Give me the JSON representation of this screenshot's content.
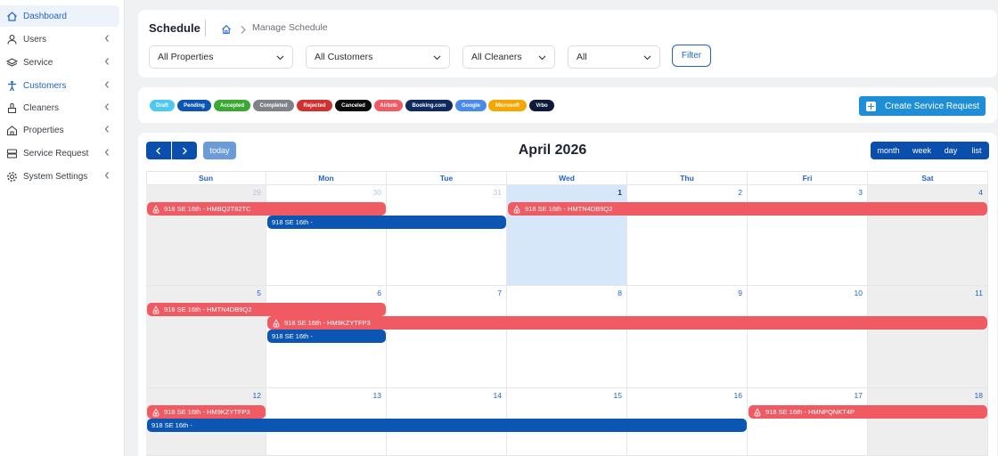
{
  "sidebar": {
    "items": [
      {
        "label": "Dashboard",
        "icon": "home-icon",
        "active": true,
        "chevron": false
      },
      {
        "label": "Users",
        "icon": "user-icon",
        "chevron": true
      },
      {
        "label": "Service",
        "icon": "layers-icon",
        "chevron": true
      },
      {
        "label": "Customers",
        "icon": "person-icon",
        "chevron": true,
        "highlight": true
      },
      {
        "label": "Cleaners",
        "icon": "brush-icon",
        "chevron": true
      },
      {
        "label": "Properties",
        "icon": "house-icon",
        "chevron": true
      },
      {
        "label": "Service Request",
        "icon": "server-icon",
        "chevron": true
      },
      {
        "label": "System Settings",
        "icon": "gear-icon",
        "chevron": true
      }
    ]
  },
  "header": {
    "title": "Schedule",
    "breadcrumb": "Manage Schedule",
    "filters": [
      {
        "value": "All Properties"
      },
      {
        "value": "All Customers"
      },
      {
        "value": "All Cleaners"
      },
      {
        "value": "All"
      }
    ],
    "filter_button": "Filter"
  },
  "legend": {
    "items": [
      {
        "label": "Draft",
        "color": "#4cc9f0"
      },
      {
        "label": "Pending",
        "color": "#0b55b3"
      },
      {
        "label": "Accepted",
        "color": "#3aa832"
      },
      {
        "label": "Completed",
        "color": "#7f8288"
      },
      {
        "label": "Rejected",
        "color": "#d22f2f"
      },
      {
        "label": "Canceled",
        "color": "#0b0b0b"
      },
      {
        "label": "Airbnb",
        "color": "#f05a63"
      },
      {
        "label": "Booking.com",
        "color": "#0f2a5e"
      },
      {
        "label": "Google",
        "color": "#4a8ae8"
      },
      {
        "label": "Microsoft",
        "color": "#f5a700"
      },
      {
        "label": "Vrbo",
        "color": "#0d1a3a"
      }
    ],
    "create_button": "Create Service Request"
  },
  "calendar": {
    "title": "April 2026",
    "today_label": "today",
    "views": [
      "month",
      "week",
      "day",
      "list"
    ],
    "weekdays": [
      "Sun",
      "Mon",
      "Tue",
      "Wed",
      "Thu",
      "Fri",
      "Sat"
    ],
    "weeks": [
      [
        {
          "d": "29",
          "other": true
        },
        {
          "d": "30",
          "other": true
        },
        {
          "d": "31",
          "other": true
        },
        {
          "d": "1",
          "today": true
        },
        {
          "d": "2"
        },
        {
          "d": "3"
        },
        {
          "d": "4"
        }
      ],
      [
        {
          "d": "5"
        },
        {
          "d": "6"
        },
        {
          "d": "7"
        },
        {
          "d": "8"
        },
        {
          "d": "9"
        },
        {
          "d": "10"
        },
        {
          "d": "11"
        }
      ],
      [
        {
          "d": "12"
        },
        {
          "d": "13"
        },
        {
          "d": "14"
        },
        {
          "d": "15"
        },
        {
          "d": "16"
        },
        {
          "d": "17"
        },
        {
          "d": "18"
        }
      ]
    ],
    "events": [
      {
        "title": "918 SE 16th - HMBQ2T82TC",
        "type": "airbnb",
        "week": 0,
        "start": 0,
        "end": 2,
        "row": 0,
        "startOffset": 0
      },
      {
        "title": "918 SE 16th - HMTN4DB9Q2",
        "type": "airbnb",
        "week": 0,
        "start": 3,
        "end": 7,
        "row": 0,
        "startOffset": 0
      },
      {
        "title": "918 SE 16th -",
        "type": "blue",
        "week": 0,
        "start": 1,
        "end": 3,
        "row": 1,
        "startOffset": 0
      },
      {
        "title": "918 SE 16th - HMTN4DB9Q2",
        "type": "airbnb",
        "week": 1,
        "start": 0,
        "end": 2,
        "row": 0,
        "startOffset": 0
      },
      {
        "title": "918 SE 16th - HM9KZYTFP3",
        "type": "airbnb",
        "week": 1,
        "start": 1,
        "end": 7,
        "row": 1,
        "startOffset": 0
      },
      {
        "title": "918 SE 16th -",
        "type": "blue",
        "week": 1,
        "start": 1,
        "end": 2,
        "row": 2,
        "startOffset": 0
      },
      {
        "title": "918 SE 16th - HM9KZYTFP3",
        "type": "airbnb",
        "week": 2,
        "start": 0,
        "end": 1,
        "row": 0,
        "startOffset": 0
      },
      {
        "title": "918 SE 16th - HMNPQNKT4P",
        "type": "airbnb",
        "week": 2,
        "start": 5,
        "end": 7,
        "row": 0,
        "startOffset": 0
      },
      {
        "title": "918 SE 16th -",
        "type": "blue",
        "week": 2,
        "start": 0,
        "end": 5,
        "row": 1,
        "startOffset": 0
      }
    ]
  }
}
